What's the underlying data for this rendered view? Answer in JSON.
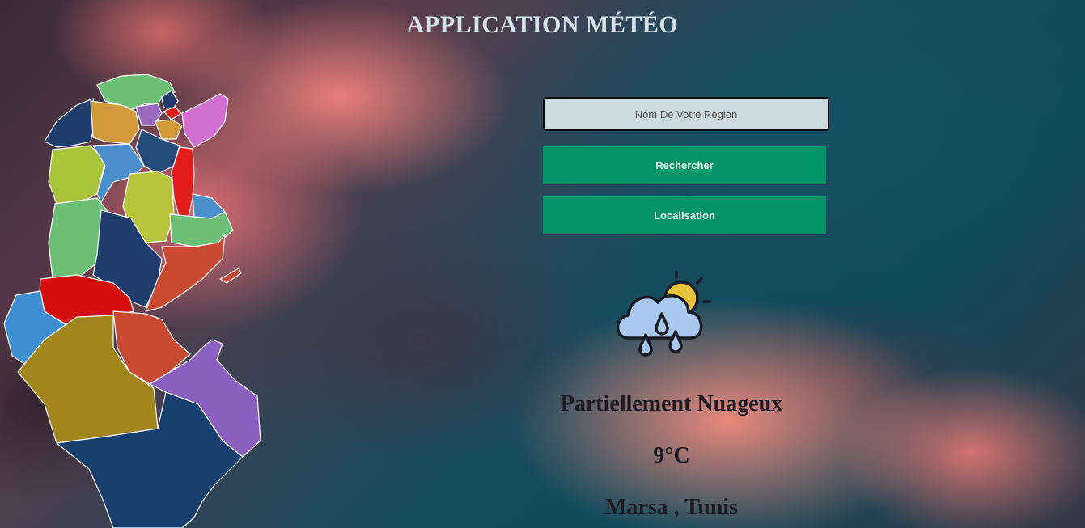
{
  "app": {
    "title": "APPLICATION MÉTÉO"
  },
  "search": {
    "placeholder": "Nom De Votre Region",
    "value": ""
  },
  "buttons": {
    "search_label": "Rechercher",
    "location_label": "Localisation"
  },
  "weather": {
    "icon": "partly-cloudy-rain-icon",
    "description": "Partiellement Nuageux",
    "temperature": "9°C",
    "location": "Marsa , Tunis"
  },
  "colors": {
    "button": "#049566",
    "title": "#d6e4ea",
    "text": "#1e1a22"
  }
}
